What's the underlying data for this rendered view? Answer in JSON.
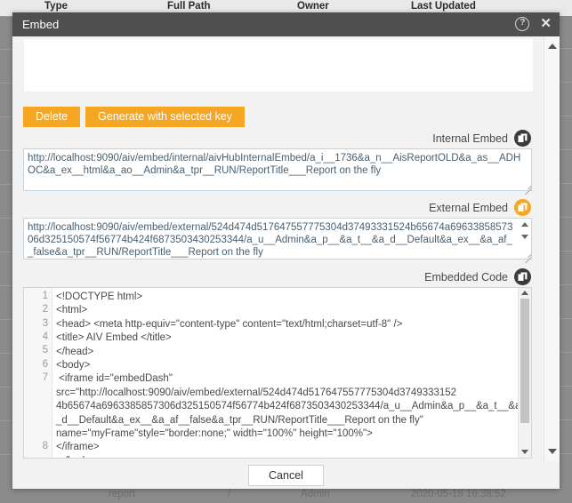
{
  "background": {
    "table_headers": [
      "Type",
      "Full Path",
      "Owner",
      "Last Updated"
    ],
    "bottom_row": [
      "report",
      "/",
      "Admin",
      "2020-05-18 16:38:52"
    ]
  },
  "modal": {
    "title": "Embed",
    "help_icon_glyph": "?",
    "close_icon_glyph": "✕",
    "toolbar": {
      "delete_label": "Delete",
      "generate_label": "Generate with selected key"
    },
    "fields": [
      {
        "label": "Internal Embed",
        "copy_icon": "copy-icon",
        "copy_style": "dark",
        "value": "http://localhost:9090/aiv/embed/internal/aivHubInternalEmbed/a_i__1736&a_n__AisReportOLD&a_as__ADHOC&a_ex__html&a_ao__Admin&a_tpr__RUN/ReportTitle___Report on the fly"
      },
      {
        "label": "External Embed",
        "copy_icon": "copy-icon",
        "copy_style": "orange",
        "value": "http://localhost:9090/aiv/embed/external/524d474d517647557775304d37493331524b65674a6963385857306d325150574f56774b424f6873503430253344/a_u__Admin&a_p__&a_t__&a_d__Default&a_ex__&a_af__false&a_tpr__RUN/ReportTitle___Report on the fly"
      }
    ],
    "code": {
      "label": "Embedded Code",
      "copy_icon": "copy-icon",
      "copy_style": "dark",
      "line_numbers": [
        "1",
        "2",
        "3",
        "4",
        "5",
        "6",
        "7",
        "8"
      ],
      "text": "<!DOCTYPE html>\n<html>\n<head> <meta http-equiv=\"content-type\" content=\"text/html;charset=utf-8\" />\n<title> AIV Embed </title>\n</head>\n<body>\n <iframe id=\"embedDash\" src=\"http://localhost:9090/aiv/embed/external/524d474d517647557775304d3749333152 4b65674a6963385857306d325150574f56774b424f6873503430253344/a_u__Admin&a_p__&a_t__&a_d__Default&a_ex__&a_af__false&a_tpr__RUN/ReportTitle___Report on the fly\" name=\"myFrame\"style=\"border:none;\" width=\"100%\" height=\"100%\">\n</iframe>\n </body>"
    },
    "footer": {
      "cancel_label": "Cancel"
    }
  }
}
